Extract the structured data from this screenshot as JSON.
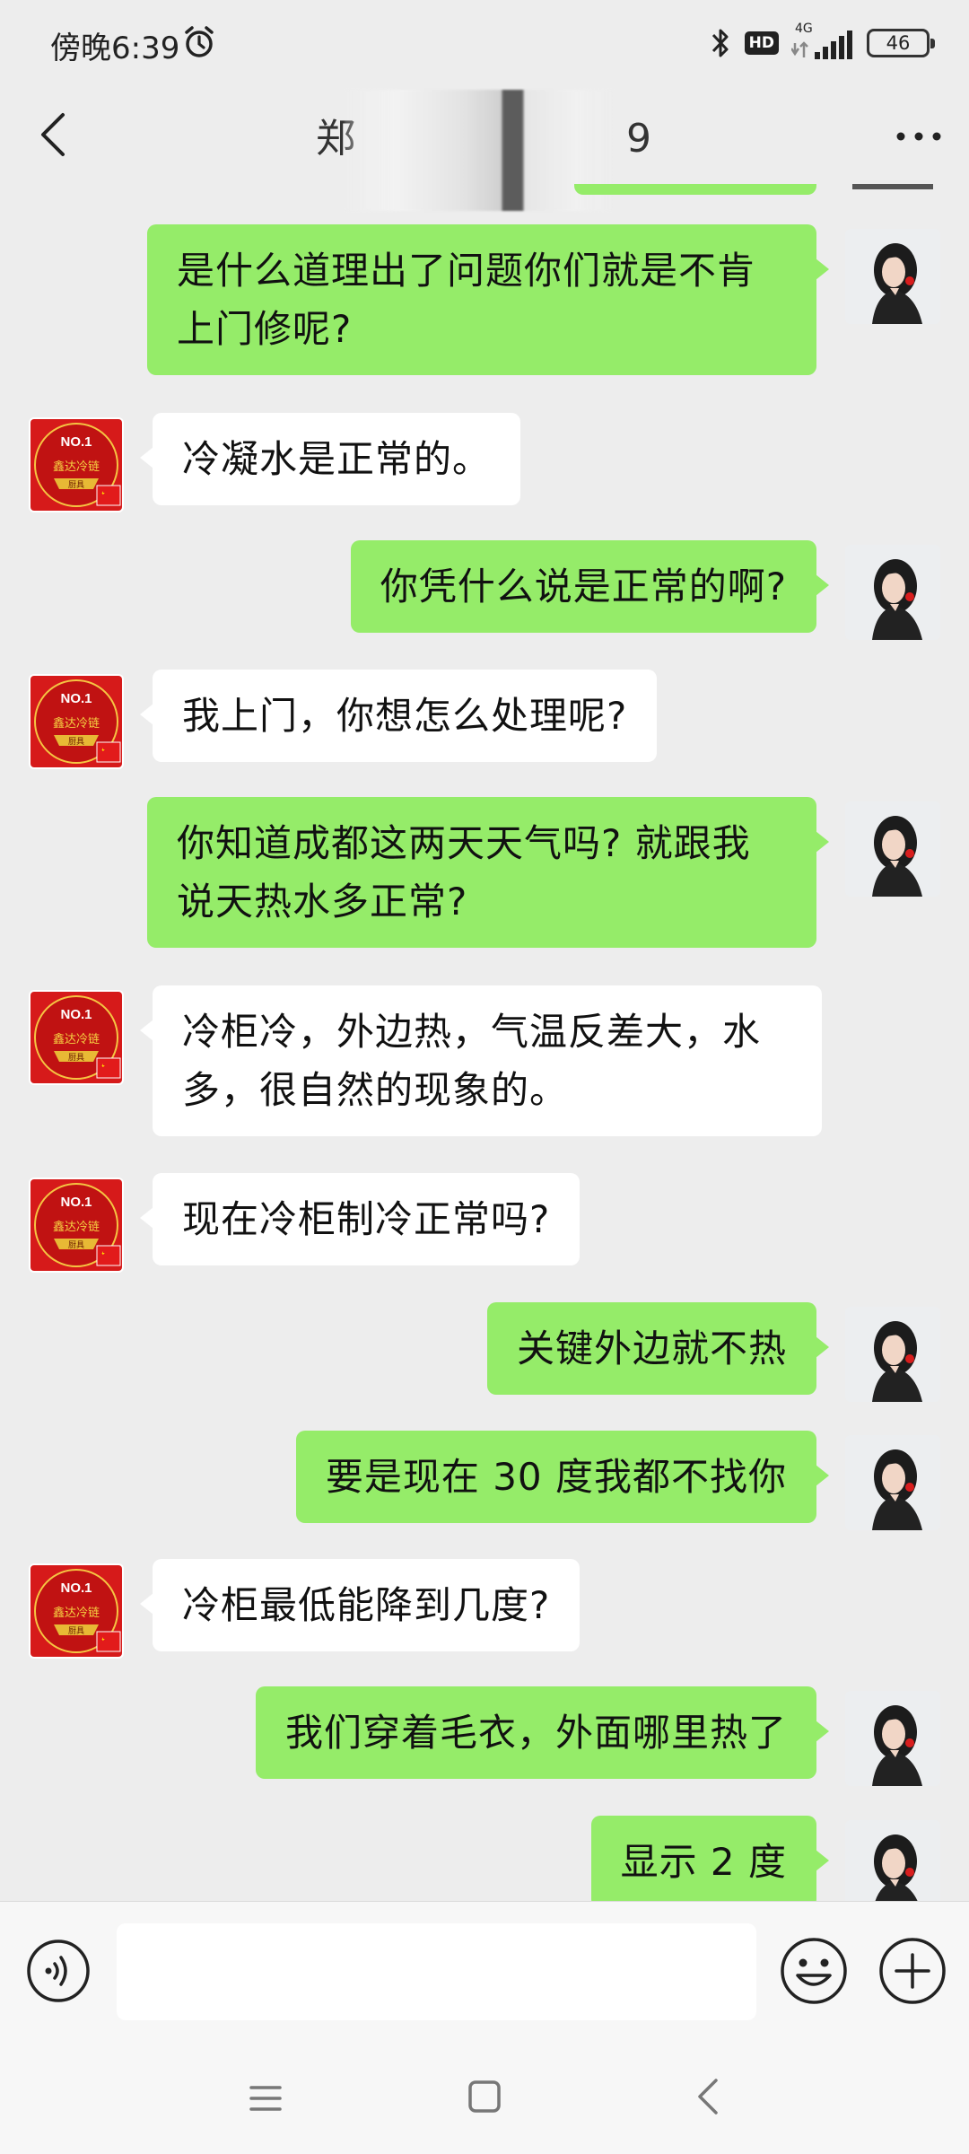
{
  "status_bar": {
    "time": "傍晚6:39",
    "hd_label": "HD",
    "network_label": "4G",
    "battery_level": "46"
  },
  "nav": {
    "title_left": "郑",
    "title_right": "9"
  },
  "icons": {
    "back": "chevron-left-icon",
    "more": "more-dots-icon",
    "alarm": "alarm-clock-icon",
    "voice": "voice-input-icon",
    "emoji": "emoji-icon",
    "plus": "plus-icon"
  },
  "colors": {
    "background": "#ededed",
    "outgoing_bubble": "#95ec69",
    "incoming_bubble": "#ffffff",
    "input_bar": "#f7f7f7"
  },
  "messages": [
    {
      "side": "right",
      "text": "是什么道理出了问题你们就是不肯上门修呢?"
    },
    {
      "side": "left",
      "text": "冷凝水是正常的。"
    },
    {
      "side": "right",
      "text": "你凭什么说是正常的啊?"
    },
    {
      "side": "left",
      "text": "我上门，你想怎么处理呢?"
    },
    {
      "side": "right",
      "text": "你知道成都这两天天气吗? 就跟我说天热水多正常?"
    },
    {
      "side": "left",
      "text": "冷柜冷，外边热，气温反差大，水多，很自然的现象的。"
    },
    {
      "side": "left",
      "text": "现在冷柜制冷正常吗?"
    },
    {
      "side": "right",
      "text": "关键外边就不热"
    },
    {
      "side": "right",
      "text": "要是现在 30 度我都不找你"
    },
    {
      "side": "left",
      "text": "冷柜最低能降到几度?"
    },
    {
      "side": "right",
      "text": "我们穿着毛衣，外面哪里热了"
    },
    {
      "side": "right",
      "text": "显示 2 度"
    }
  ],
  "avatars": {
    "merchant_logo_text": "NO.1",
    "merchant_logo_script": "鑫达冷链",
    "merchant_logo_tag": "厨具"
  },
  "input": {
    "value": "",
    "placeholder": ""
  }
}
